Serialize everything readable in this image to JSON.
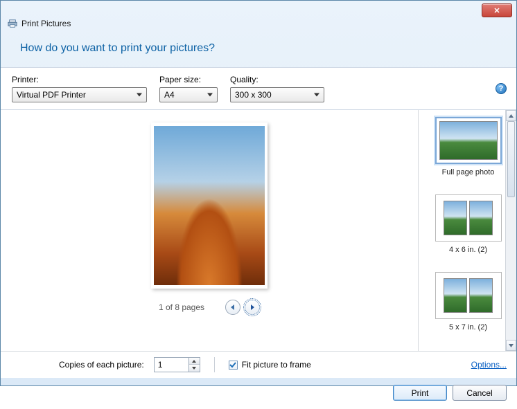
{
  "window": {
    "title": "Print Pictures"
  },
  "heading": "How do you want to print your pictures?",
  "controls": {
    "printer_label": "Printer:",
    "printer_value": "Virtual PDF Printer",
    "paper_label": "Paper size:",
    "paper_value": "A4",
    "quality_label": "Quality:",
    "quality_value": "300 x 300",
    "help": "?"
  },
  "preview": {
    "pager_text": "1 of 8 pages"
  },
  "layouts": [
    {
      "label": "Full page photo",
      "type": "full",
      "selected": true
    },
    {
      "label": "4 x 6 in. (2)",
      "type": "two",
      "selected": false
    },
    {
      "label": "5 x 7 in. (2)",
      "type": "two",
      "selected": false
    }
  ],
  "footer": {
    "copies_label": "Copies of each picture:",
    "copies_value": "1",
    "fit_label": "Fit picture to frame",
    "fit_checked": true,
    "options_link": "Options...",
    "print_btn": "Print",
    "cancel_btn": "Cancel"
  },
  "close_glyph": "✕"
}
